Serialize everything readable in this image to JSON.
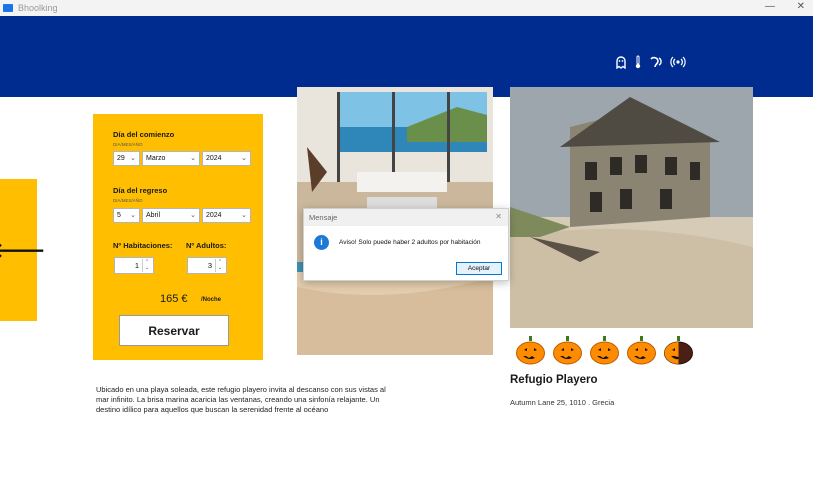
{
  "window": {
    "title": "Bhoolking",
    "minimize": "—",
    "close": "✕"
  },
  "header": {
    "icons": [
      "ghost-icon",
      "thermometer-icon",
      "hearing-icon",
      "wireless-icon"
    ]
  },
  "back": {
    "icon": "arrow-left-icon",
    "glyph": "🡐"
  },
  "form": {
    "start_label": "Día del comienzo",
    "start_hint": "DIA/MES/AÑO",
    "start_day": "29",
    "start_month": "Marzo",
    "start_year": "2024",
    "return_label": "Día del regreso",
    "return_hint": "DIA/MES/AÑO",
    "return_day": "5",
    "return_month": "Abril",
    "return_year": "2024",
    "rooms_label": "Nº Habitaciones:",
    "rooms_value": "1",
    "adults_label": "Nº Adultos:",
    "adults_value": "3",
    "price": "165 €",
    "per_night": "/Noche",
    "book_label": "Reservar"
  },
  "listing": {
    "name": "Refugio Playero",
    "address": "Autumn Lane 25, 1010 . Grecia",
    "rating": 4.5,
    "rating_max": 5,
    "description": "Ubicado en una playa soleada, este refugio playero invita al descanso con sus vistas al mar infinito. La brisa marina acaricia las ventanas, creando una sinfonía relajante. Un destino idílico para aquellos que buscan la serenidad frente al océano"
  },
  "dialog": {
    "title": "Mensaje",
    "close": "✕",
    "message": "Aviso! Solo puede haber 2 adultos por habitación",
    "ok_label": "Aceptar",
    "icon": "info-icon"
  },
  "colors": {
    "header": "#002b8f",
    "accent": "#ffbf00",
    "pumpkin": "#ff8c00"
  }
}
